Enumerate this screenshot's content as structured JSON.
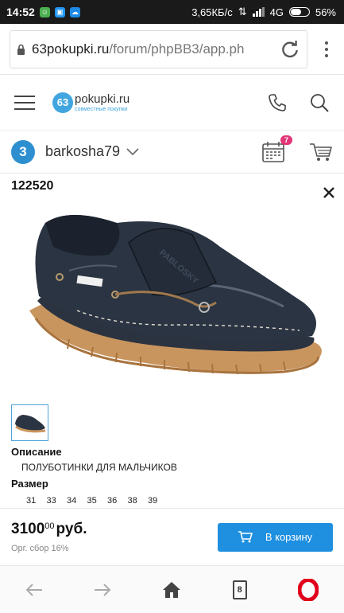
{
  "status_bar": {
    "time": "14:52",
    "speed": "3,65КБ/с",
    "network": "4G",
    "battery": "56%"
  },
  "browser": {
    "url_host": "63pokupki.ru",
    "url_path": "/forum/phpBB3/app.ph"
  },
  "site": {
    "logo_number": "63",
    "logo_name": "pokupki.ru",
    "logo_tagline": "совместные покупки"
  },
  "user": {
    "avatar_letter": "3",
    "name": "barkosha79",
    "calendar_badge": "7"
  },
  "product": {
    "id": "122520",
    "description_title": "Описание",
    "description": "ПОЛУБОТИНКИ ДЛЯ МАЛЬЧИКОВ",
    "size_title": "Размер",
    "sizes": [
      "31",
      "33",
      "34",
      "35",
      "36",
      "38",
      "39"
    ],
    "shoe_brand": "PABLOSKY"
  },
  "purchase": {
    "price_main": "3100",
    "price_cents": "00",
    "currency": "руб.",
    "fee": "Орг. сбор 16%",
    "cart_button": "В корзину"
  },
  "bottom_nav": {
    "tabs_count": "8"
  },
  "colors": {
    "accent": "#1f8fe0",
    "badge": "#e23679",
    "opera": "#e0001b"
  },
  "icons": [
    "lock-icon",
    "reload-icon",
    "menu-icon",
    "phone-icon",
    "search-icon",
    "chevron-down-icon",
    "calendar-icon",
    "cart-icon",
    "close-icon",
    "back-icon",
    "forward-icon",
    "home-icon",
    "tabs-icon",
    "opera-icon"
  ]
}
